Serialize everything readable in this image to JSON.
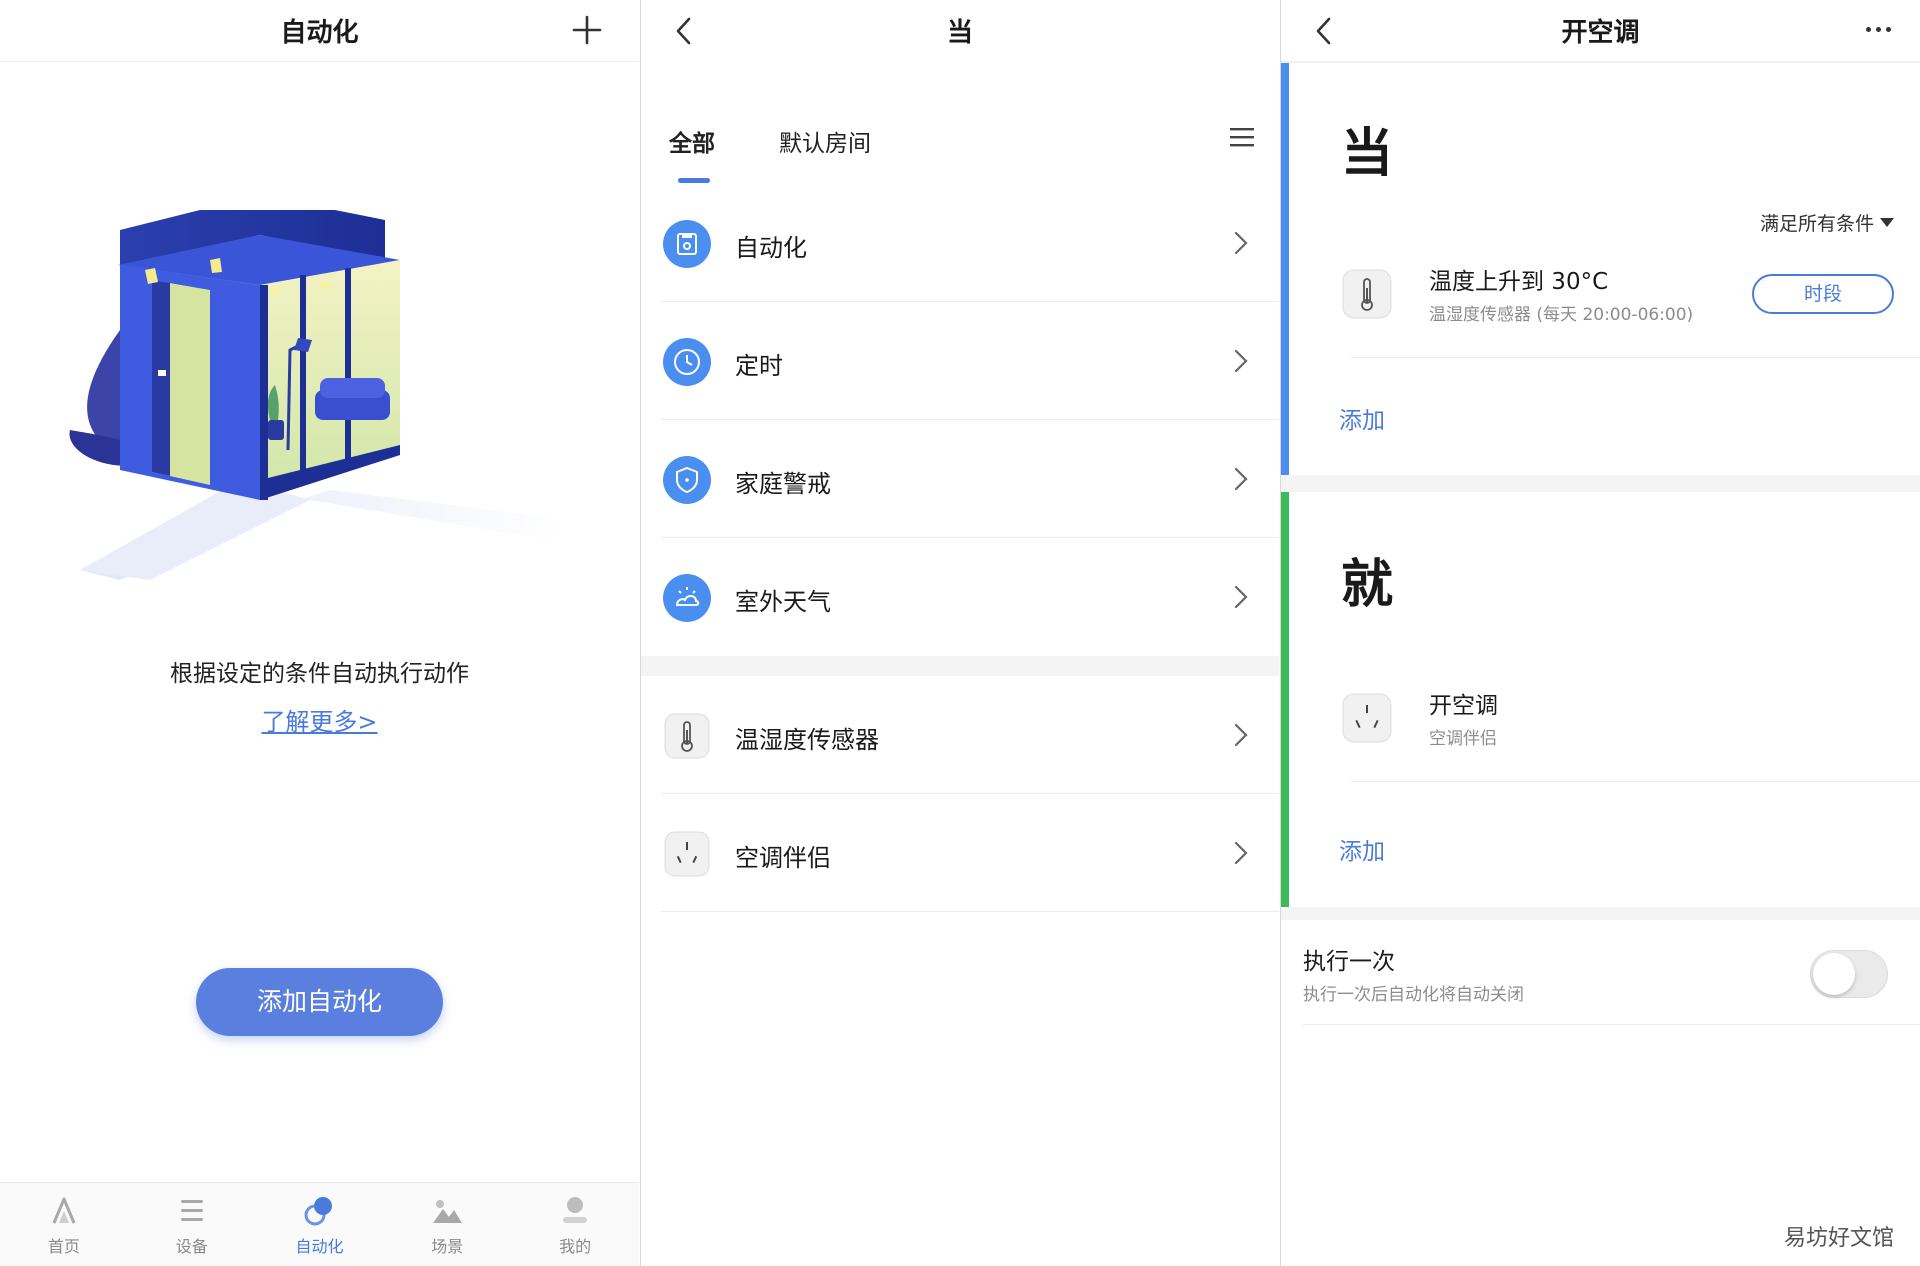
{
  "panel1": {
    "title": "自动化",
    "description": "根据设定的条件自动执行动作",
    "learn_more": "了解更多>",
    "add_button": "添加自动化",
    "tabs": [
      {
        "label": "首页",
        "icon": "home-icon",
        "active": false
      },
      {
        "label": "设备",
        "icon": "device-list-icon",
        "active": false
      },
      {
        "label": "自动化",
        "icon": "automation-icon",
        "active": true
      },
      {
        "label": "场景",
        "icon": "scene-icon",
        "active": false
      },
      {
        "label": "我的",
        "icon": "profile-icon",
        "active": false
      }
    ]
  },
  "panel2": {
    "title": "当",
    "tabs": [
      {
        "label": "全部",
        "active": true
      },
      {
        "label": "默认房间",
        "active": false
      }
    ],
    "condition_items": [
      {
        "label": "自动化",
        "icon": "automation-icon"
      },
      {
        "label": "定时",
        "icon": "clock-icon"
      },
      {
        "label": "家庭警戒",
        "icon": "shield-icon"
      },
      {
        "label": "室外天气",
        "icon": "weather-icon"
      }
    ],
    "device_items": [
      {
        "label": "温湿度传感器",
        "icon": "thermometer-icon"
      },
      {
        "label": "空调伴侣",
        "icon": "ac-companion-icon"
      }
    ]
  },
  "panel3": {
    "title": "开空调",
    "when_heading": "当",
    "condition_mode": "满足所有条件",
    "condition": {
      "title": "温度上升到 30°C",
      "subtitle": "温湿度传感器 (每天 20:00-06:00)",
      "period_button": "时段"
    },
    "add_condition": "添加",
    "then_heading": "就",
    "action": {
      "title": "开空调",
      "subtitle": "空调伴侣"
    },
    "add_action": "添加",
    "run_once": {
      "title": "执行一次",
      "subtitle": "执行一次后自动化将自动关闭",
      "enabled": false
    }
  },
  "watermark": "易坊好文馆",
  "colors": {
    "accent": "#4a7bdc",
    "button": "#5a7fdf",
    "when_bar": "#4a8ff0",
    "then_bar": "#3dbb5a"
  }
}
